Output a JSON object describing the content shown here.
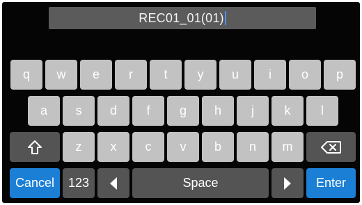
{
  "input": {
    "value": "REC01_01(01)"
  },
  "keyboard": {
    "row1": [
      "q",
      "w",
      "e",
      "r",
      "t",
      "y",
      "u",
      "i",
      "o",
      "p"
    ],
    "row2": [
      "a",
      "s",
      "d",
      "f",
      "g",
      "h",
      "j",
      "k",
      "l"
    ],
    "row3": [
      "z",
      "x",
      "c",
      "v",
      "b",
      "n",
      "m"
    ],
    "cancel_label": "Cancel",
    "numbers_label": "123",
    "space_label": "Space",
    "enter_label": "Enter"
  },
  "icons": {
    "shift": "shift-icon",
    "backspace": "backspace-icon",
    "left": "cursor-left-icon",
    "right": "cursor-right-icon"
  },
  "colors": {
    "screen_bg": "#050505",
    "key": "#c2c2c2",
    "dark_key": "#545454",
    "accent": "#1b7fd6"
  }
}
